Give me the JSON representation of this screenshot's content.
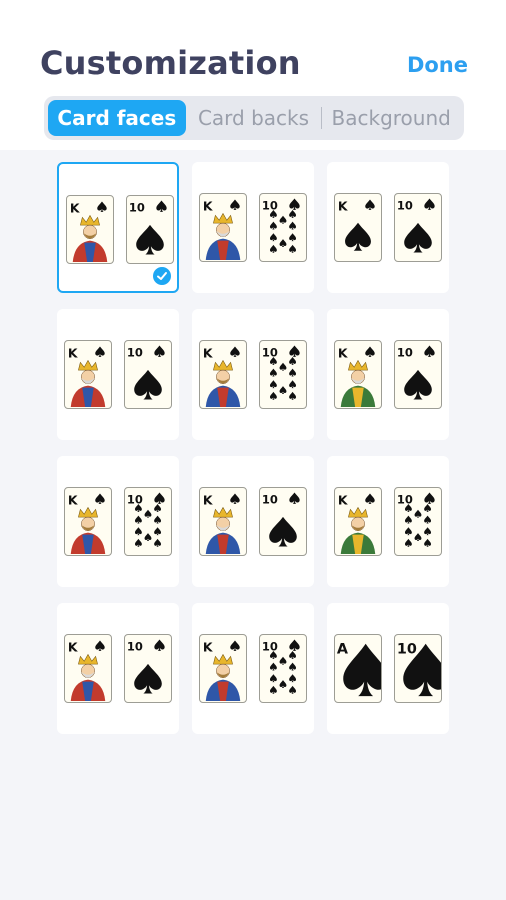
{
  "header": {
    "title": "Customization",
    "done_label": "Done"
  },
  "tabs": [
    {
      "label": "Card faces",
      "active": true
    },
    {
      "label": "Card backs",
      "active": false
    },
    {
      "label": "Background",
      "active": false
    }
  ],
  "colors": {
    "accent": "#1ea7f3",
    "title": "#3f4260",
    "done": "#2c9ff0",
    "content_bg": "#f4f5f9"
  },
  "face_options": [
    {
      "index_labels": [
        "K",
        "10"
      ],
      "style": "classic-king-big-spade",
      "selected": true
    },
    {
      "index_labels": [
        "K",
        "10"
      ],
      "style": "classic-king-pips",
      "selected": false
    },
    {
      "index_labels": [
        "K",
        "10"
      ],
      "style": "simple-spades",
      "selected": false
    },
    {
      "index_labels": [
        "K",
        "10"
      ],
      "style": "bold-king-big-spade",
      "selected": false
    },
    {
      "index_labels": [
        "K",
        "10"
      ],
      "style": "bold-king-pips",
      "selected": false
    },
    {
      "index_labels": [
        "K",
        "10"
      ],
      "style": "serif-king-big-spade",
      "selected": false
    },
    {
      "index_labels": [
        "K",
        "10"
      ],
      "style": "ornate-king-pips",
      "selected": false
    },
    {
      "index_labels": [
        "K",
        "10"
      ],
      "style": "ornate-king-big-spade",
      "selected": false
    },
    {
      "index_labels": [
        "K",
        "10"
      ],
      "style": "ornate-king-pips-2",
      "selected": false
    },
    {
      "index_labels": [
        "K",
        "10"
      ],
      "style": "royal-king-big-spade",
      "selected": false
    },
    {
      "index_labels": [
        "K",
        "10"
      ],
      "style": "royal-king-pips",
      "selected": false
    },
    {
      "index_labels": [
        "A",
        "10"
      ],
      "style": "giant-spades",
      "selected": false
    }
  ]
}
